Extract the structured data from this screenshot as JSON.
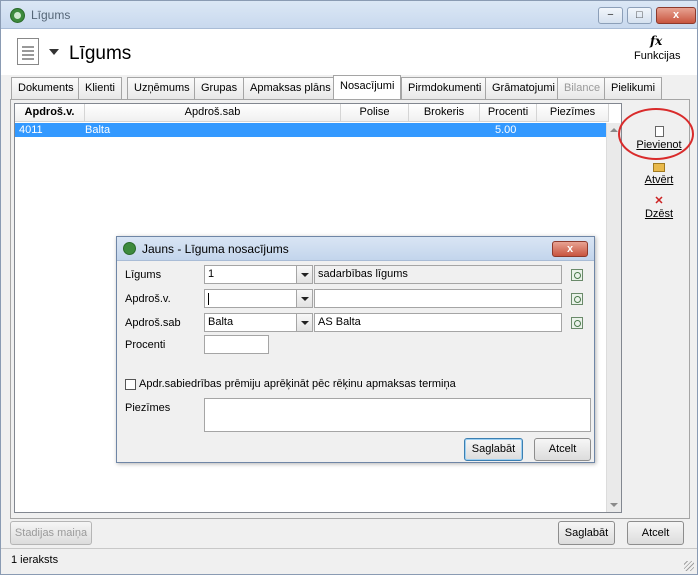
{
  "window": {
    "title": "Līgums",
    "minimize": "−",
    "maximize": "□",
    "close": "x"
  },
  "header": {
    "title": "Līgums",
    "functions_icon": "fx",
    "functions_label": "Funkcijas"
  },
  "tabs": [
    {
      "label": "Dokuments",
      "state": "normal"
    },
    {
      "label": "Klienti",
      "state": "normal"
    },
    {
      "label": "Uzņēmums",
      "state": "normal"
    },
    {
      "label": "Grupas",
      "state": "normal"
    },
    {
      "label": "Apmaksas plāns",
      "state": "normal"
    },
    {
      "label": "Nosacījumi",
      "state": "active"
    },
    {
      "label": "Pirmdokumenti",
      "state": "normal"
    },
    {
      "label": "Grāmatojumi",
      "state": "normal"
    },
    {
      "label": "Bilance",
      "state": "disabled"
    },
    {
      "label": "Pielikumi",
      "state": "normal"
    }
  ],
  "grid": {
    "columns": [
      "Apdroš.v.",
      "Apdroš.sab",
      "Polise",
      "Brokeris",
      "Procenti",
      "Piezīmes"
    ],
    "rows": [
      {
        "apdros_v": "4011",
        "apdros_sab": "Balta",
        "polise": "",
        "brokeris": "",
        "procenti": "5.00",
        "piezimes": ""
      }
    ]
  },
  "side_actions": {
    "add": "Pievienot",
    "open": "Atvērt",
    "delete": "Dzēst"
  },
  "footer": {
    "stage_change": "Stadijas maiņa",
    "save": "Saglabāt",
    "cancel": "Atcelt"
  },
  "status": {
    "record_count": "1 ieraksts"
  },
  "dialog": {
    "title": "Jauns - Līguma nosacījums",
    "close": "x",
    "fields": {
      "ligums_label": "Līgums",
      "ligums_value": "1",
      "ligums_desc": "sadarbības līgums",
      "apdros_v_label": "Apdroš.v.",
      "apdros_v_value": "",
      "apdros_v_desc": "",
      "apdros_sab_label": "Apdroš.sab",
      "apdros_sab_value": "Balta",
      "apdros_sab_desc": "AS Balta",
      "procenti_label": "Procenti",
      "procenti_value": "",
      "checkbox_label": "Apdr.sabiedrības prēmiju aprēķināt pēc rēķinu apmaksas termiņa",
      "checkbox_checked": false,
      "piezimes_label": "Piezīmes",
      "piezimes_value": ""
    },
    "save": "Saglabāt",
    "cancel": "Atcelt"
  },
  "colors": {
    "selection": "#3399ff",
    "highlight_ring": "#d92b2b"
  }
}
